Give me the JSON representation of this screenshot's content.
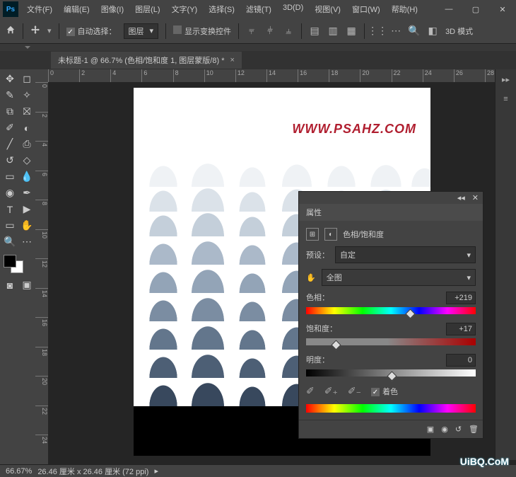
{
  "app": {
    "name": "Ps"
  },
  "menu": {
    "file": "文件(F)",
    "edit": "编辑(E)",
    "image": "图像(I)",
    "layer": "图层(L)",
    "type": "文字(Y)",
    "select": "选择(S)",
    "filter": "滤镜(T)",
    "3d": "3D(D)",
    "view": "视图(V)",
    "window": "窗口(W)",
    "help": "帮助(H)"
  },
  "options": {
    "auto_select_label": "自动选择：",
    "target_dropdown": "图层",
    "show_transform_label": "显示变换控件",
    "mode_label": "3D 模式"
  },
  "tab": {
    "title": "未标题-1 @ 66.7% (色相/饱和度 1, 图层蒙版/8) *"
  },
  "ruler_h": [
    "0",
    "2",
    "4",
    "6",
    "8",
    "10",
    "12",
    "14",
    "16",
    "18",
    "20",
    "22",
    "24",
    "26",
    "28"
  ],
  "ruler_v": [
    "0",
    "2",
    "4",
    "6",
    "8",
    "10",
    "12",
    "14",
    "16",
    "18",
    "20",
    "22",
    "24"
  ],
  "canvas": {
    "watermark": "WWW.PSAHZ.COM",
    "corner_watermark": "UiBQ.CoM"
  },
  "panel": {
    "title": "属性",
    "adj_label": "色相/饱和度",
    "preset_label": "预设：",
    "preset_value": "自定",
    "range_value": "全图",
    "hue_label": "色相：",
    "hue_value": "+219",
    "sat_label": "饱和度：",
    "sat_value": "+17",
    "light_label": "明度：",
    "light_value": "0",
    "colorize_label": "着色"
  },
  "status": {
    "zoom": "66.67%",
    "dims": "26.46 厘米 x 26.46 厘米 (72 ppi)"
  }
}
